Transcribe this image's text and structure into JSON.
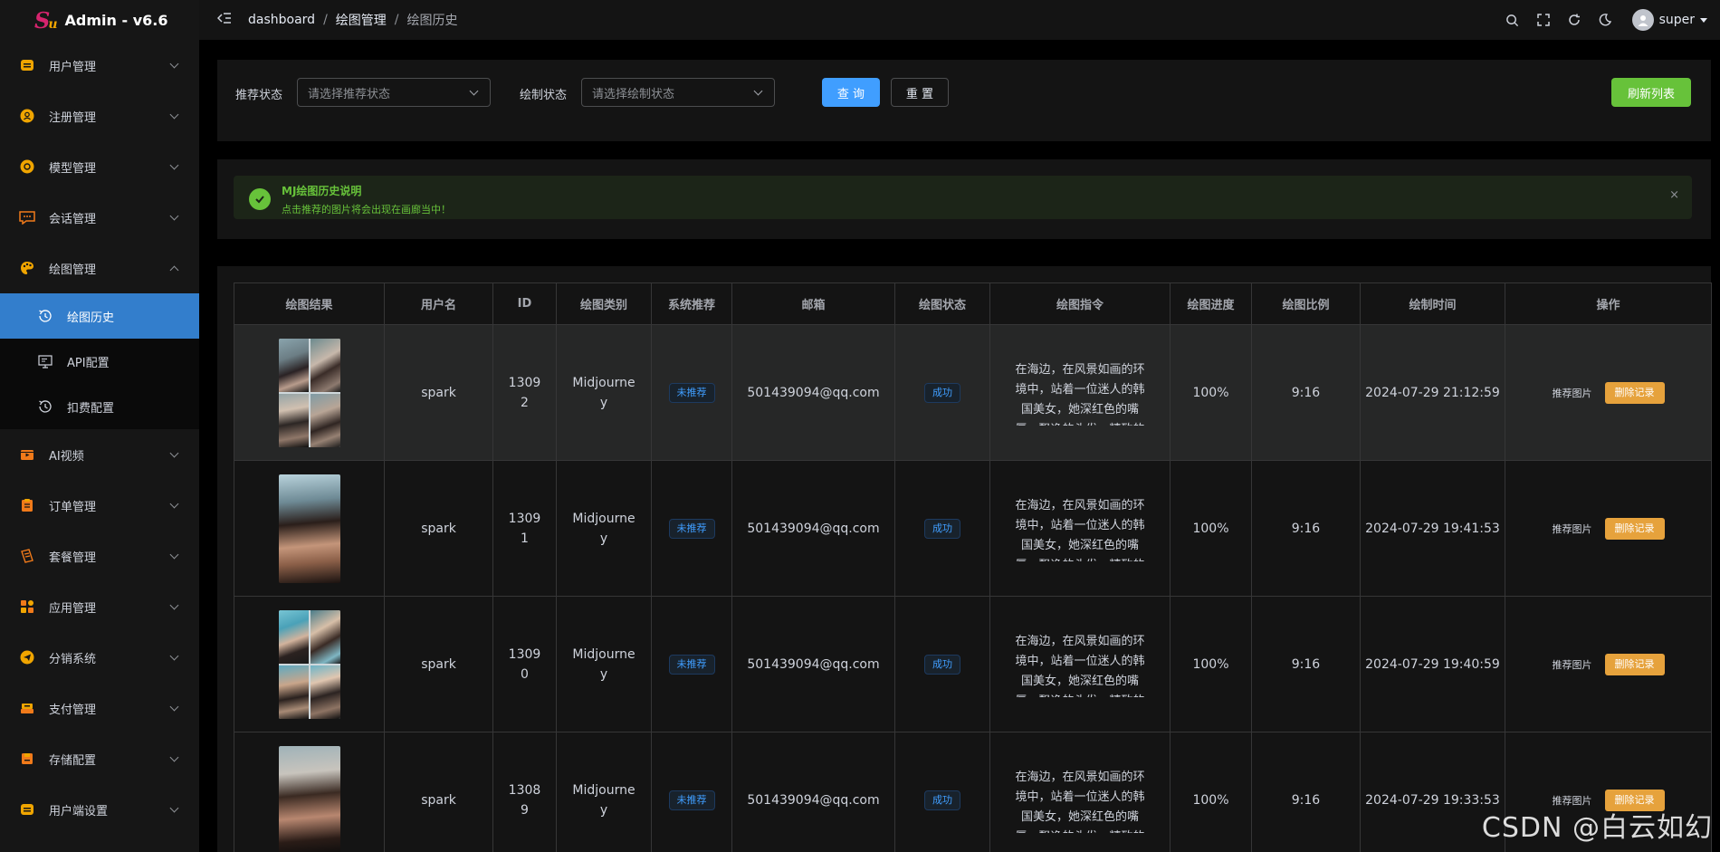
{
  "app": {
    "logo_mark": "S",
    "logo_sub": "u",
    "title": "Admin - v6.6"
  },
  "header": {
    "breadcrumbs": [
      "dashboard",
      "绘图管理",
      "绘图历史"
    ],
    "user": "super"
  },
  "sidebar": {
    "items": [
      {
        "label": "用户管理",
        "icon": "user-card-icon",
        "color": "#f0a500"
      },
      {
        "label": "注册管理",
        "icon": "register-icon",
        "color": "#f0a500"
      },
      {
        "label": "模型管理",
        "icon": "model-icon",
        "color": "#f0a500"
      },
      {
        "label": "会话管理",
        "icon": "chat-icon",
        "color": "#f07a1a"
      },
      {
        "label": "绘图管理",
        "icon": "palette-icon",
        "color": "#f0a500",
        "expanded": true
      },
      {
        "label": "AI视频",
        "icon": "video-icon",
        "color": "#f07a1a"
      },
      {
        "label": "订单管理",
        "icon": "order-icon",
        "color": "#f07a1a"
      },
      {
        "label": "套餐管理",
        "icon": "package-icon",
        "color": "#f07a1a"
      },
      {
        "label": "应用管理",
        "icon": "apps-icon",
        "color": "#f07a1a"
      },
      {
        "label": "分销系统",
        "icon": "send-icon",
        "color": "#f0a500"
      },
      {
        "label": "支付管理",
        "icon": "payment-icon",
        "color": "#f0a500"
      },
      {
        "label": "存储配置",
        "icon": "storage-icon",
        "color": "#f07a1a"
      },
      {
        "label": "用户端设置",
        "icon": "settings-icon",
        "color": "#f0a500"
      }
    ],
    "submenu": [
      {
        "label": "绘图历史",
        "active": true
      },
      {
        "label": "API配置"
      },
      {
        "label": "扣费配置"
      }
    ]
  },
  "filters": {
    "recommend_label": "推荐状态",
    "recommend_placeholder": "请选择推荐状态",
    "draw_label": "绘制状态",
    "draw_placeholder": "请选择绘制状态",
    "query_button": "查 询",
    "reset_button": "重 置",
    "refresh_button": "刷新列表"
  },
  "notice": {
    "title": "MJ绘图历史说明",
    "description": "点击推荐的图片将会出现在画廊当中！",
    "close": "×"
  },
  "table": {
    "headers": [
      "绘图结果",
      "用户名",
      "ID",
      "绘图类别",
      "系统推荐",
      "邮箱",
      "绘图状态",
      "绘图指令",
      "绘图进度",
      "绘图比例",
      "绘制时间",
      "操作"
    ],
    "rows": [
      {
        "thumb": "grid-a",
        "user": "spark",
        "id": "13092",
        "category": "Midjourney",
        "recommend": "未推荐",
        "email": "501439094@qq.com",
        "status": "成功",
        "prompt": "在海边，在风景如画的环境中，站着一位迷人的韩国美女，她深红色的嘴唇，飘逸的头发，精致的",
        "progress": "100%",
        "ratio": "9:16",
        "time": "2024-07-29 21:12:59",
        "op_recommend": "推荐图片",
        "op_delete": "删除记录"
      },
      {
        "thumb": "single-a",
        "user": "spark",
        "id": "13091",
        "category": "Midjourney",
        "recommend": "未推荐",
        "email": "501439094@qq.com",
        "status": "成功",
        "prompt": "在海边，在风景如画的环境中，站着一位迷人的韩国美女，她深红色的嘴唇，飘逸的头发，精致的",
        "progress": "100%",
        "ratio": "9:16",
        "time": "2024-07-29 19:41:53",
        "op_recommend": "推荐图片",
        "op_delete": "删除记录"
      },
      {
        "thumb": "grid-b",
        "user": "spark",
        "id": "13090",
        "category": "Midjourney",
        "recommend": "未推荐",
        "email": "501439094@qq.com",
        "status": "成功",
        "prompt": "在海边，在风景如画的环境中，站着一位迷人的韩国美女，她深红色的嘴唇，飘逸的头发，精致的",
        "progress": "100%",
        "ratio": "9:16",
        "time": "2024-07-29 19:40:59",
        "op_recommend": "推荐图片",
        "op_delete": "删除记录"
      },
      {
        "thumb": "single-b",
        "user": "spark",
        "id": "13089",
        "category": "Midjourney",
        "recommend": "未推荐",
        "email": "501439094@qq.com",
        "status": "成功",
        "prompt": "在海边，在风景如画的环境中，站着一位迷人的韩国美女，她深红色的嘴唇，飘逸的头发，精致的",
        "progress": "100%",
        "ratio": "9:16",
        "time": "2024-07-29 19:33:53",
        "op_recommend": "推荐图片",
        "op_delete": "删除记录"
      }
    ]
  },
  "watermark": "CSDN @白云如幻"
}
